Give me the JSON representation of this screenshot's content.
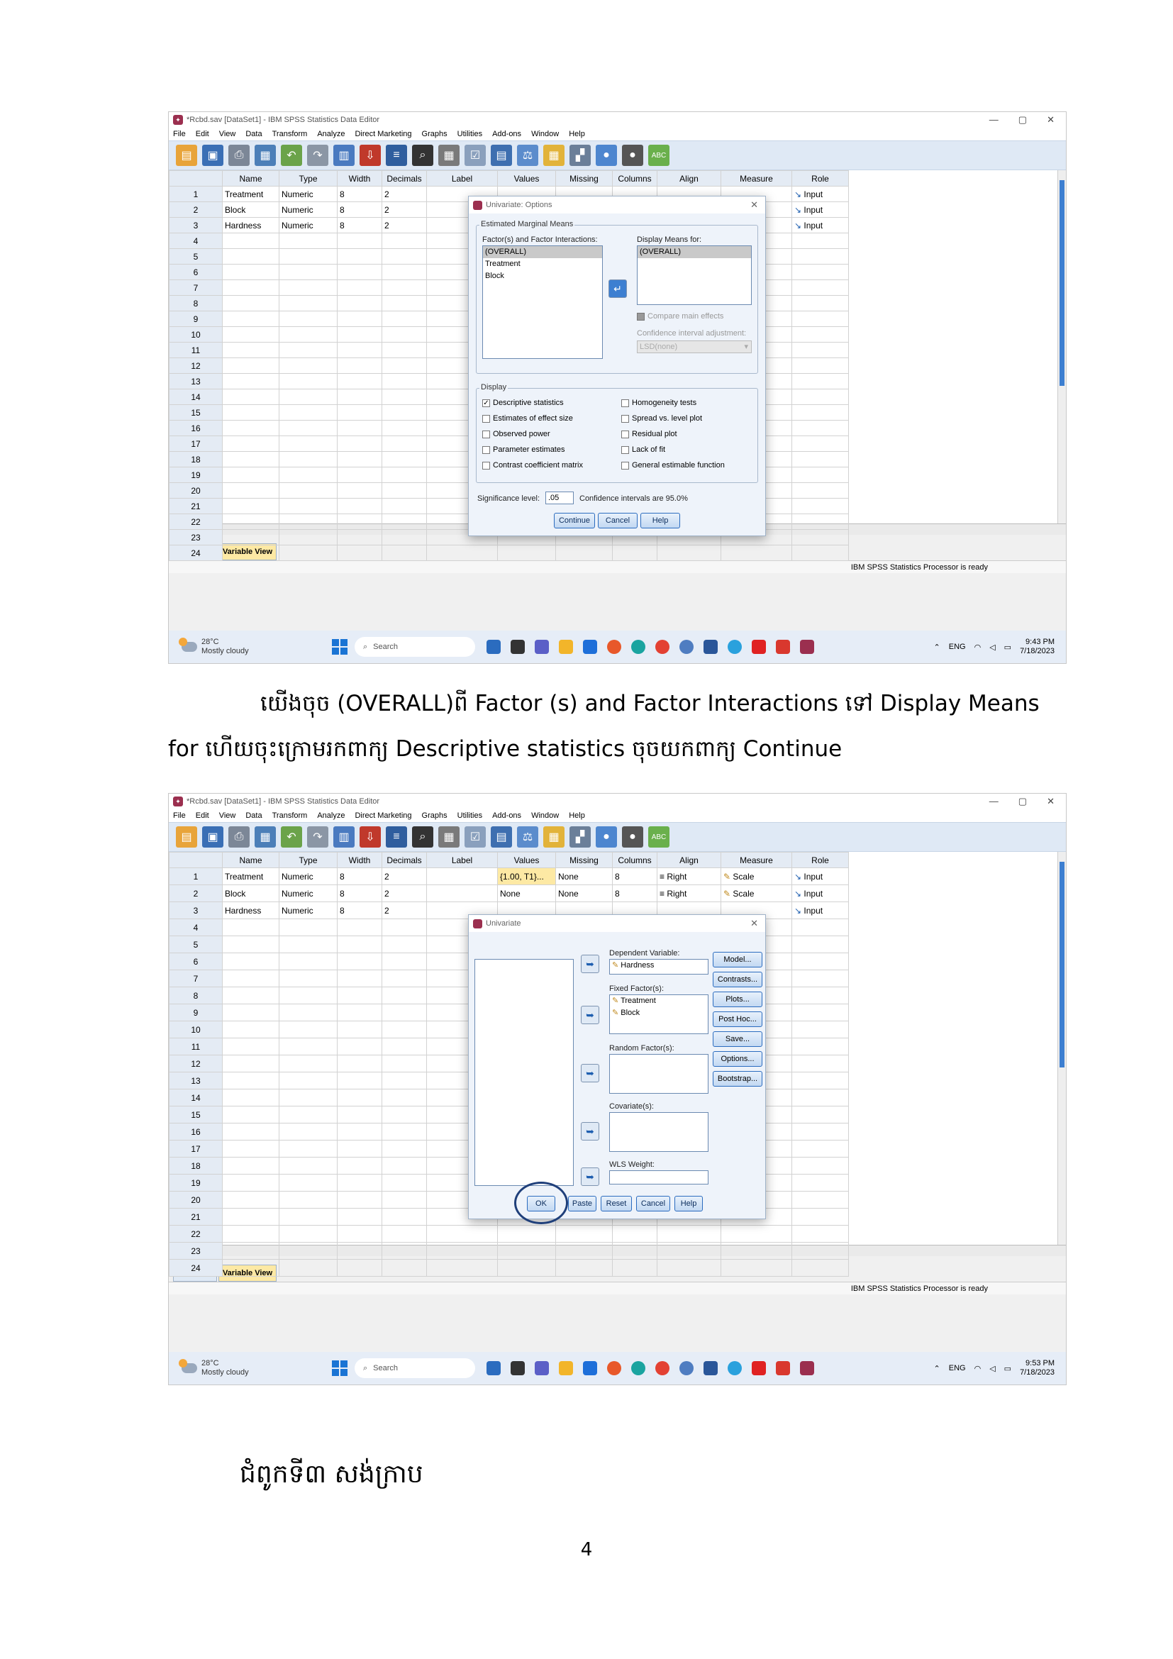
{
  "screenshot1": {
    "window_title": "*Rcbd.sav [DataSet1] - IBM SPSS Statistics Data Editor",
    "menu": [
      "File",
      "Edit",
      "View",
      "Data",
      "Transform",
      "Analyze",
      "Direct Marketing",
      "Graphs",
      "Utilities",
      "Add-ons",
      "Window",
      "Help"
    ],
    "columns": [
      "Name",
      "Type",
      "Width",
      "Decimals",
      "Label",
      "Values",
      "Missing",
      "Columns",
      "Align",
      "Measure",
      "Role"
    ],
    "rows": [
      {
        "num": "1",
        "name": "Treatment",
        "type": "Numeric",
        "width": "8",
        "decimals": "2",
        "role": "Input"
      },
      {
        "num": "2",
        "name": "Block",
        "type": "Numeric",
        "width": "8",
        "decimals": "2",
        "role": "Input"
      },
      {
        "num": "3",
        "name": "Hardness",
        "type": "Numeric",
        "width": "8",
        "decimals": "2",
        "role": "Input"
      }
    ],
    "empty_rows": [
      "4",
      "5",
      "6",
      "7",
      "8",
      "9",
      "10",
      "11",
      "12",
      "13",
      "14",
      "15",
      "16",
      "17",
      "18",
      "19",
      "20",
      "21",
      "22",
      "23",
      "24"
    ],
    "tabs": [
      "Data View",
      "Variable View"
    ],
    "status": "IBM SPSS Statistics Processor is ready",
    "taskbar": {
      "temp": "28°C",
      "weather": "Mostly cloudy",
      "search": "Search",
      "lang": "ENG",
      "time": "9:43 PM",
      "date": "7/18/2023"
    },
    "dialog": {
      "title": "Univariate: Options",
      "emm_legend": "Estimated Marginal Means",
      "factors_label": "Factor(s) and Factor Interactions:",
      "factors": [
        "(OVERALL)",
        "Treatment",
        "Block"
      ],
      "display_means_label": "Display Means for:",
      "display_means": [
        "(OVERALL)"
      ],
      "compare_main": "Compare main effects",
      "ci_adjust": "Confidence interval adjustment:",
      "ci_value": "LSD(none)",
      "display_legend": "Display",
      "checks_left": [
        "Descriptive statistics",
        "Estimates of effect size",
        "Observed power",
        "Parameter estimates",
        "Contrast coefficient matrix"
      ],
      "checks_right": [
        "Homogeneity tests",
        "Spread vs. level plot",
        "Residual plot",
        "Lack of fit",
        "General estimable function"
      ],
      "checked": "Descriptive statistics",
      "sig_label": "Significance level:",
      "sig_value": ".05",
      "ci_text": "Confidence intervals are 95.0%",
      "buttons": [
        "Continue",
        "Cancel",
        "Help"
      ]
    }
  },
  "paragraph": {
    "line1": "យើងចុច (OVERALL)ពី Factor (s) and Factor Interactions ទៅ Display Means",
    "line2": "for ហើយចុះក្រោមរកពាក្យ Descriptive statistics ចុចយកពាក្យ Continue"
  },
  "screenshot2": {
    "window_title": "*Rcbd.sav [DataSet1] - IBM SPSS Statistics Data Editor",
    "rows": [
      {
        "num": "1",
        "name": "Treatment",
        "type": "Numeric",
        "width": "8",
        "decimals": "2",
        "values": "{1.00, T1}...",
        "missing": "None",
        "columns": "8",
        "align": "Right",
        "measure": "Scale",
        "role": "Input"
      },
      {
        "num": "2",
        "name": "Block",
        "type": "Numeric",
        "width": "8",
        "decimals": "2",
        "values": "None",
        "missing": "None",
        "columns": "8",
        "align": "Right",
        "measure": "Scale",
        "role": "Input"
      },
      {
        "num": "3",
        "name": "Hardness",
        "type": "Numeric",
        "width": "8",
        "decimals": "2",
        "role": "Input"
      }
    ],
    "taskbar": {
      "temp": "28°C",
      "weather": "Mostly cloudy",
      "search": "Search",
      "lang": "ENG",
      "time": "9:53 PM",
      "date": "7/18/2023"
    },
    "dialog": {
      "title": "Univariate",
      "dep_label": "Dependent Variable:",
      "dep_value": "Hardness",
      "fixed_label": "Fixed Factor(s):",
      "fixed_values": [
        "Treatment",
        "Block"
      ],
      "random_label": "Random Factor(s):",
      "covariate_label": "Covariate(s):",
      "wls_label": "WLS Weight:",
      "side_buttons": [
        "Model...",
        "Contrasts...",
        "Plots...",
        "Post Hoc...",
        "Save...",
        "Options...",
        "Bootstrap..."
      ],
      "buttons": [
        "OK",
        "Paste",
        "Reset",
        "Cancel",
        "Help"
      ]
    }
  },
  "caption": "ជំពូកទី៣ សង់ក្រាប",
  "page_number": "4"
}
